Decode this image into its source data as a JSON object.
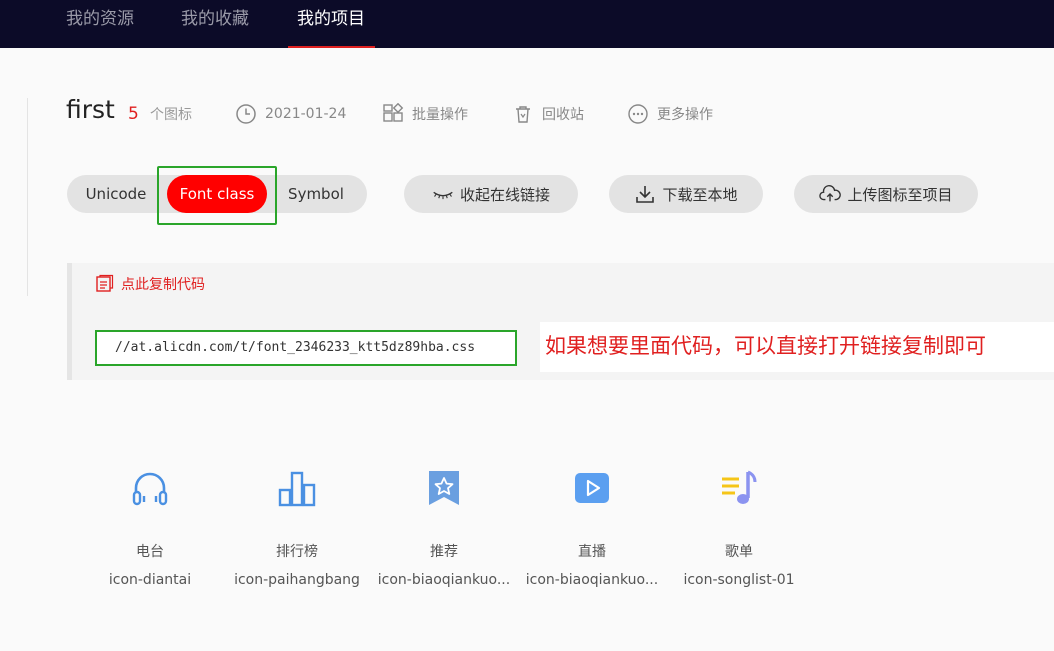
{
  "nav": {
    "tabs": [
      {
        "label": "我的资源"
      },
      {
        "label": "我的收藏"
      },
      {
        "label": "我的项目",
        "active": true
      }
    ]
  },
  "project": {
    "title": "first",
    "icon_count": "5",
    "icon_count_label": "个图标",
    "date": "2021-01-24",
    "batch_label": "批量操作",
    "recycle_label": "回收站",
    "more_label": "更多操作"
  },
  "modes": {
    "items": [
      {
        "label": "Unicode"
      },
      {
        "label": "Font class",
        "active": true
      },
      {
        "label": "Symbol"
      }
    ]
  },
  "actions": {
    "collapse_link_label": "收起在线链接",
    "download_label": "下载至本地",
    "upload_label": "上传图标至项目"
  },
  "code": {
    "copy_label": "点此复制代码",
    "url": "//at.alicdn.com/t/font_2346233_ktt5dz89hba.css",
    "annotation": "如果想要里面代码，可以直接打开链接复制即可"
  },
  "icons": [
    {
      "name": "电台",
      "code": "icon-diantai",
      "icon": "headphones-icon",
      "color": "#4a90e2"
    },
    {
      "name": "排行榜",
      "code": "icon-paihangbang",
      "icon": "bar-chart-icon",
      "color": "#4a90e2"
    },
    {
      "name": "推荐",
      "code": "icon-biaoqiankuo...",
      "icon": "bookmark-star-icon",
      "color": "#6a9fe0"
    },
    {
      "name": "直播",
      "code": "icon-biaoqiankuo...",
      "icon": "video-play-icon",
      "color": "#5b9ff0"
    },
    {
      "name": "歌单",
      "code": "icon-songlist-01",
      "icon": "music-note-icon",
      "color": "#8b93f0"
    }
  ],
  "colors": {
    "nav_bg": "#0c0b28",
    "accent_red": "#ff0000",
    "highlight_green": "#2aa52a"
  }
}
